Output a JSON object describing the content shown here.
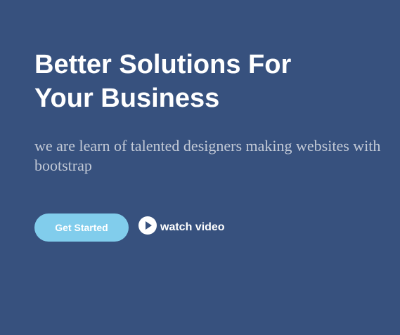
{
  "hero": {
    "title_line1": "Better Solutions For",
    "title_line2": "Your Business",
    "subtitle": "we are learn of talented designers making websites with bootstrap"
  },
  "actions": {
    "get_started_label": "Get Started",
    "watch_video_label": "watch video",
    "watch_icon": "play-circle-icon"
  },
  "colors": {
    "background": "#37517e",
    "button": "#81cdec",
    "subtitle_text": "#c2c9d6",
    "text": "#ffffff"
  }
}
